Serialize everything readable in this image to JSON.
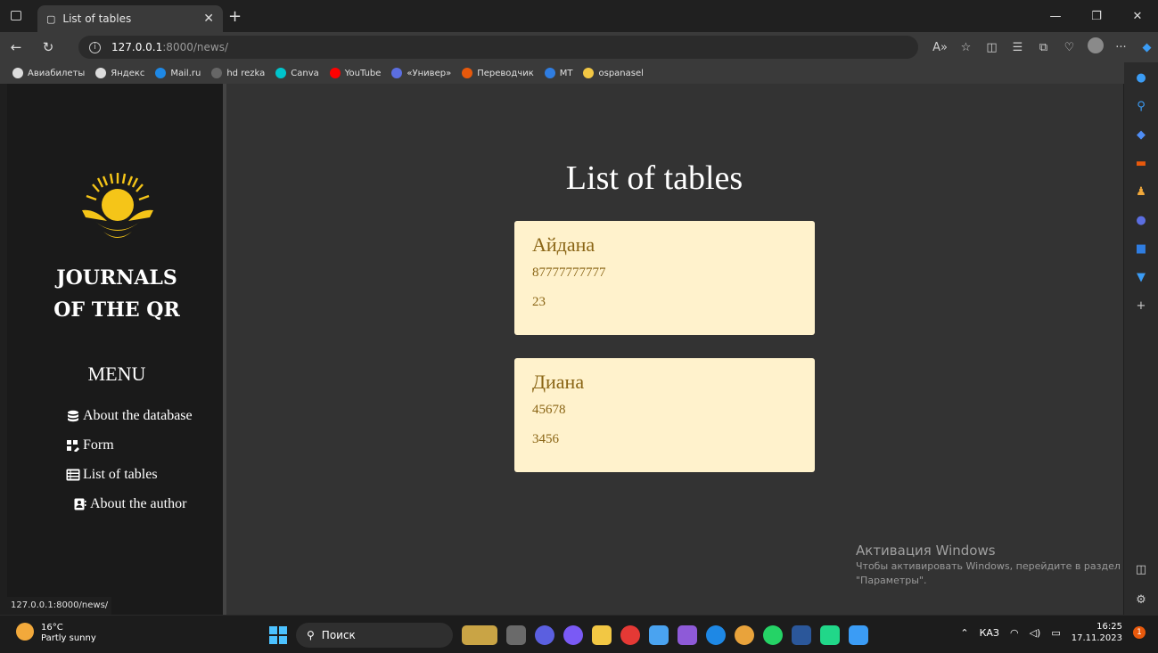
{
  "browser": {
    "tab_title": "List of tables",
    "url_host": "127.0.0.1",
    "url_path": ":8000/news/",
    "bookmarks": [
      {
        "label": "Авиабилеты",
        "color": "#dcdcdc"
      },
      {
        "label": "Яндекс",
        "color": "#dcdcdc"
      },
      {
        "label": "Mail.ru",
        "color": "#1e88e5"
      },
      {
        "label": "hd rezka",
        "color": "#666666"
      },
      {
        "label": "Canva",
        "color": "#00c4cc"
      },
      {
        "label": "YouTube",
        "color": "#ff0000"
      },
      {
        "label": "«Универ»",
        "color": "#5b6ee1"
      },
      {
        "label": "Переводчик",
        "color": "#e8590c"
      },
      {
        "label": "MT",
        "color": "#2f7de1"
      },
      {
        "label": "ospanasel",
        "color": "#f2c744"
      }
    ],
    "status_url": "127.0.0.1:8000/news/"
  },
  "sidebar": {
    "brand_line1": "JOURNALS",
    "brand_line2": "OF THE QR",
    "menu_title": "MENU",
    "items": [
      {
        "label": "About the database",
        "icon": "database-icon"
      },
      {
        "label": "Form",
        "icon": "form-icon"
      },
      {
        "label": "List of tables",
        "icon": "table-list-icon"
      },
      {
        "label": "About the author",
        "icon": "address-card-icon"
      }
    ]
  },
  "main": {
    "title": "List of tables",
    "cards": [
      {
        "name": "Айдана",
        "phone": "87777777777",
        "value": "23"
      },
      {
        "name": "Диана",
        "phone": "45678",
        "value": "3456"
      }
    ]
  },
  "activation": {
    "title": "Активация Windows",
    "line1": "Чтобы активировать Windows, перейдите в раздел",
    "line2": "\"Параметры\"."
  },
  "taskbar": {
    "temperature": "16°C",
    "weather": "Partly sunny",
    "search_placeholder": "Поиск",
    "language": "КАЗ",
    "time": "16:25",
    "date": "17.11.2023",
    "notification_count": "1"
  },
  "colors": {
    "card_bg": "#fff2cc",
    "card_text": "#8a6515",
    "emblem_gold": "#f5c518"
  }
}
